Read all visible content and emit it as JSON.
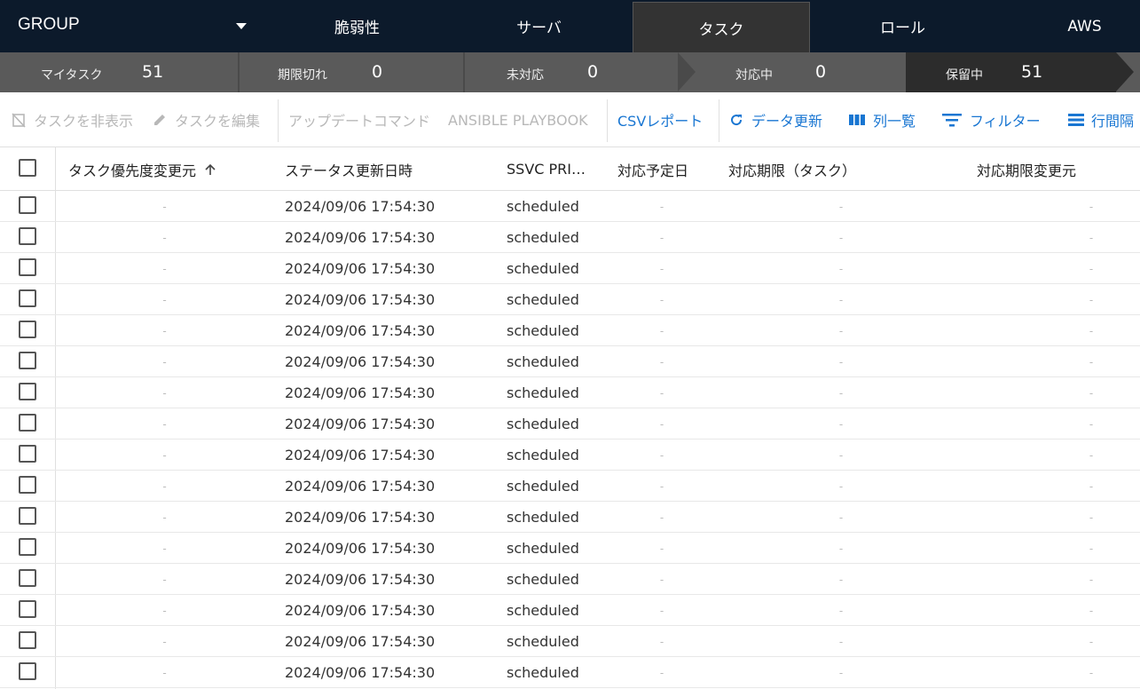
{
  "topnav": {
    "group_label": "GROUP",
    "tabs": [
      {
        "label": "脆弱性",
        "active": false
      },
      {
        "label": "サーバ",
        "active": false
      },
      {
        "label": "タスク",
        "active": true
      },
      {
        "label": "ロール",
        "active": false
      },
      {
        "label": "AWS",
        "active": false
      }
    ]
  },
  "statusbar": [
    {
      "label": "マイタスク",
      "count": "51"
    },
    {
      "label": "期限切れ",
      "count": "0"
    },
    {
      "label": "未対応",
      "count": "0"
    },
    {
      "label": "対応中",
      "count": "0"
    },
    {
      "label": "保留中",
      "count": "51",
      "active": true
    }
  ],
  "toolbar": {
    "hide_task": "タスクを非表示",
    "edit_task": "タスクを編集",
    "update_command": "アップデートコマンド",
    "ansible_playbook": "ANSIBLE PLAYBOOK",
    "csv_report": "CSVレポート",
    "refresh": "データ更新",
    "columns": "列一覧",
    "filter": "フィルター",
    "row_spacing": "行間隔"
  },
  "colors": {
    "nav_bg": "#0c1a2b",
    "status_bg": "#5a5a5a",
    "accent": "#1976d2"
  },
  "table": {
    "headers": {
      "priority_source": "タスク優先度変更元",
      "status_updated": "ステータス更新日時",
      "ssvc": "SSVC PRI…",
      "scheduled_date": "対応予定日",
      "deadline": "対応期限（タスク）",
      "deadline_source": "対応期限変更元"
    },
    "rows": [
      {
        "priority_source": "-",
        "status_updated": "2024/09/06 17:54:30",
        "ssvc": "scheduled",
        "scheduled_date": "-",
        "deadline": "-",
        "deadline_source": "-"
      },
      {
        "priority_source": "-",
        "status_updated": "2024/09/06 17:54:30",
        "ssvc": "scheduled",
        "scheduled_date": "-",
        "deadline": "-",
        "deadline_source": "-"
      },
      {
        "priority_source": "-",
        "status_updated": "2024/09/06 17:54:30",
        "ssvc": "scheduled",
        "scheduled_date": "-",
        "deadline": "-",
        "deadline_source": "-"
      },
      {
        "priority_source": "-",
        "status_updated": "2024/09/06 17:54:30",
        "ssvc": "scheduled",
        "scheduled_date": "-",
        "deadline": "-",
        "deadline_source": "-"
      },
      {
        "priority_source": "-",
        "status_updated": "2024/09/06 17:54:30",
        "ssvc": "scheduled",
        "scheduled_date": "-",
        "deadline": "-",
        "deadline_source": "-"
      },
      {
        "priority_source": "-",
        "status_updated": "2024/09/06 17:54:30",
        "ssvc": "scheduled",
        "scheduled_date": "-",
        "deadline": "-",
        "deadline_source": "-"
      },
      {
        "priority_source": "-",
        "status_updated": "2024/09/06 17:54:30",
        "ssvc": "scheduled",
        "scheduled_date": "-",
        "deadline": "-",
        "deadline_source": "-"
      },
      {
        "priority_source": "-",
        "status_updated": "2024/09/06 17:54:30",
        "ssvc": "scheduled",
        "scheduled_date": "-",
        "deadline": "-",
        "deadline_source": "-"
      },
      {
        "priority_source": "-",
        "status_updated": "2024/09/06 17:54:30",
        "ssvc": "scheduled",
        "scheduled_date": "-",
        "deadline": "-",
        "deadline_source": "-"
      },
      {
        "priority_source": "-",
        "status_updated": "2024/09/06 17:54:30",
        "ssvc": "scheduled",
        "scheduled_date": "-",
        "deadline": "-",
        "deadline_source": "-"
      },
      {
        "priority_source": "-",
        "status_updated": "2024/09/06 17:54:30",
        "ssvc": "scheduled",
        "scheduled_date": "-",
        "deadline": "-",
        "deadline_source": "-"
      },
      {
        "priority_source": "-",
        "status_updated": "2024/09/06 17:54:30",
        "ssvc": "scheduled",
        "scheduled_date": "-",
        "deadline": "-",
        "deadline_source": "-"
      },
      {
        "priority_source": "-",
        "status_updated": "2024/09/06 17:54:30",
        "ssvc": "scheduled",
        "scheduled_date": "-",
        "deadline": "-",
        "deadline_source": "-"
      },
      {
        "priority_source": "-",
        "status_updated": "2024/09/06 17:54:30",
        "ssvc": "scheduled",
        "scheduled_date": "-",
        "deadline": "-",
        "deadline_source": "-"
      },
      {
        "priority_source": "-",
        "status_updated": "2024/09/06 17:54:30",
        "ssvc": "scheduled",
        "scheduled_date": "-",
        "deadline": "-",
        "deadline_source": "-"
      },
      {
        "priority_source": "-",
        "status_updated": "2024/09/06 17:54:30",
        "ssvc": "scheduled",
        "scheduled_date": "-",
        "deadline": "-",
        "deadline_source": "-"
      }
    ]
  }
}
